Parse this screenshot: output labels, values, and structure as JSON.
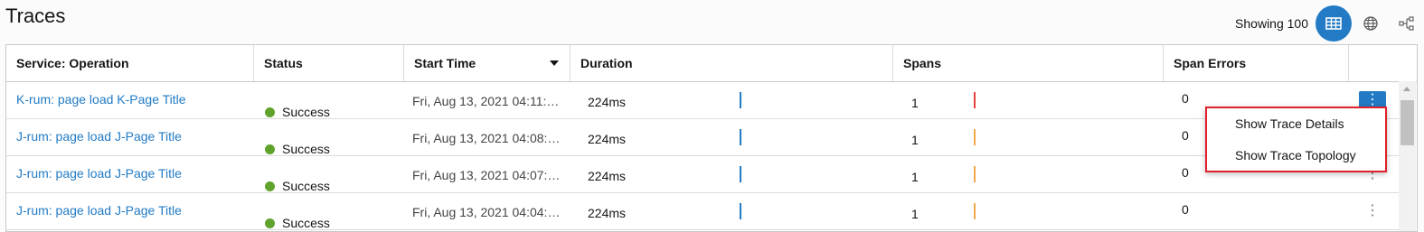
{
  "page": {
    "title": "Traces"
  },
  "toolbar": {
    "showing_label": "Showing 100",
    "icons": [
      "table-view-icon",
      "globe-icon",
      "topology-icon"
    ]
  },
  "columns": [
    "Service: Operation",
    "Status",
    "Start Time",
    "Duration",
    "Spans",
    "Span Errors"
  ],
  "sort": {
    "column": "Start Time",
    "direction": "descending"
  },
  "rows": [
    {
      "operation": "K-rum: page load K-Page Title",
      "status": "Success",
      "start_time": "Fri, Aug 13, 2021 04:11:…",
      "duration": "224ms",
      "spans": "1",
      "span_color": "#e5413b",
      "errors": "0"
    },
    {
      "operation": "J-rum: page load J-Page Title",
      "status": "Success",
      "start_time": "Fri, Aug 13, 2021 04:08:…",
      "duration": "224ms",
      "spans": "1",
      "span_color": "#f0a64a",
      "errors": "0"
    },
    {
      "operation": "J-rum: page load J-Page Title",
      "status": "Success",
      "start_time": "Fri, Aug 13, 2021 04:07:…",
      "duration": "224ms",
      "spans": "1",
      "span_color": "#f0a64a",
      "errors": "0"
    },
    {
      "operation": "J-rum: page load J-Page Title",
      "status": "Success",
      "start_time": "Fri, Aug 13, 2021 04:04:…",
      "duration": "224ms",
      "spans": "1",
      "span_color": "#f0a64a",
      "errors": "0"
    }
  ],
  "row_action": {
    "kebab": "⋮"
  },
  "context_menu": {
    "items": [
      "Show Trace Details",
      "Show Trace Topology"
    ]
  },
  "colors": {
    "accent": "#227bc4",
    "success": "#60a32c",
    "highlight_border": "#e0202b"
  }
}
